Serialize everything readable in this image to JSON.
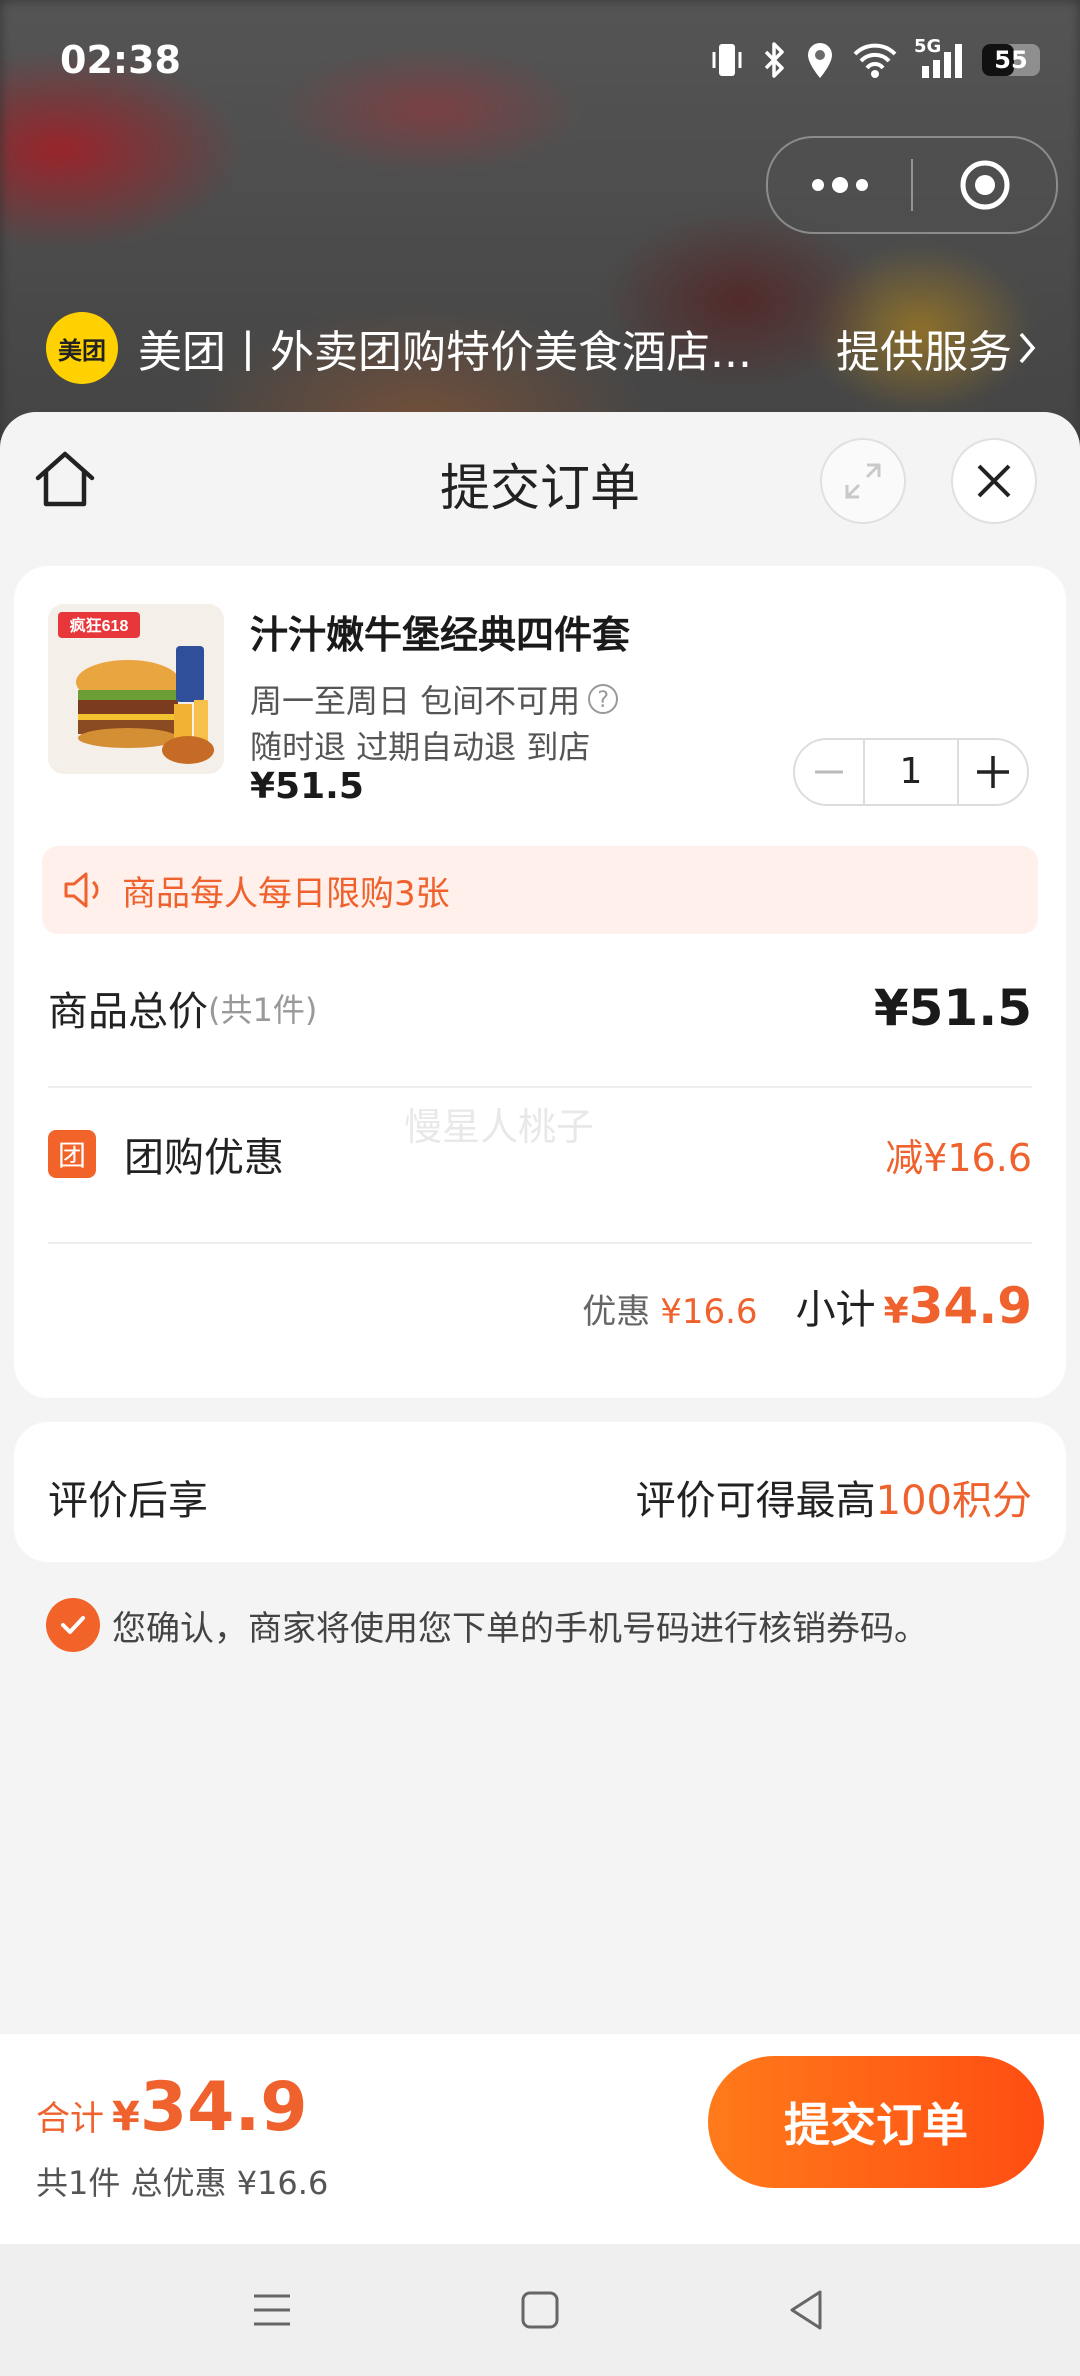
{
  "status_bar": {
    "time": "02:38",
    "network": "5G",
    "battery": "55",
    "battery_level": 0.55
  },
  "capsule": {
    "more_icon": "more-dots-icon",
    "close_icon": "target-circle-icon"
  },
  "mini_program": {
    "logo_text": "美团",
    "name": "美团丨外卖团购特价美食酒店...",
    "service_label": "提供服务"
  },
  "header": {
    "title": "提交订单",
    "home_icon": "home-icon",
    "expand_icon": "expand-icon",
    "close_icon": "close-icon"
  },
  "product": {
    "name": "汁汁嫩牛堡经典四件套",
    "line1": "周一至周日 包间不可用",
    "line2": "随时退 过期自动退 到店",
    "price": "¥51.5",
    "thumb_badge": "疯狂618",
    "quantity": "1"
  },
  "notice": {
    "text": "商品每人每日限购3张"
  },
  "summary": {
    "total_label": "商品总价",
    "total_count": "(共1件)",
    "total_value": "¥51.5",
    "discount_badge": "团",
    "discount_label": "团购优惠",
    "discount_value": "减¥16.6",
    "watermark": "慢星人桃子",
    "saving_label": "优惠",
    "saving_value": "¥16.6",
    "subtotal_label": "小计",
    "subtotal_yen": "¥",
    "subtotal_value": "34.9"
  },
  "review": {
    "label": "评价后享",
    "right_prefix": "评价可得最高",
    "right_accent": "100积分"
  },
  "agreement": {
    "checked": true,
    "text": "您确认，商家将使用您下单的手机号码进行核销券码。"
  },
  "bottom_bar": {
    "total_label": "合计",
    "total_yen": "¥",
    "total_value": "34.9",
    "sub_text": "共1件 总优惠 ¥16.6",
    "submit_label": "提交订单"
  },
  "colors": {
    "accent": "#f0622d",
    "button_start": "#ff7a1a",
    "button_end": "#ff4d12",
    "logo_yellow": "#ffd100"
  }
}
